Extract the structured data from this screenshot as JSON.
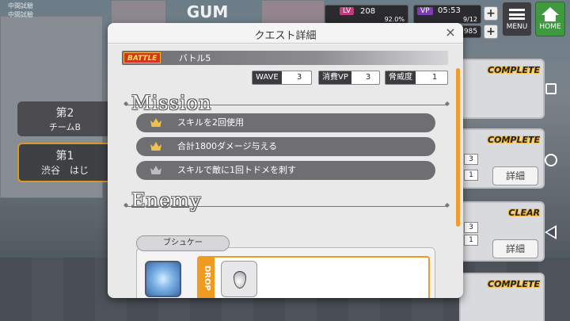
{
  "top_left": {
    "line1": "中間試驗",
    "line2": "中間試驗"
  },
  "background_sign": "GUM",
  "status": {
    "lv_label": "LV",
    "lv_value": "208",
    "lv_progress_label": "92.0%",
    "vp_label": "VP",
    "vp_time": "05:53",
    "vp_frac": "9/12",
    "coins": "985"
  },
  "menu_label": "MENU",
  "home_label": "HOME",
  "left_panels": {
    "chapter_a": "第2",
    "team": "チームB",
    "chapter_b": "第1",
    "place": "渋谷　はじ"
  },
  "quest_list": [
    {
      "status": "COMPLETE",
      "nums": [
        "",
        ""
      ],
      "detail": ""
    },
    {
      "status": "COMPLETE",
      "nums": [
        "3",
        "1"
      ],
      "detail": "詳細"
    },
    {
      "status": "CLEAR",
      "nums": [
        "3",
        "1"
      ],
      "detail": "詳細"
    },
    {
      "status": "COMPLETE",
      "nums": [
        "",
        ""
      ],
      "detail": ""
    }
  ],
  "modal": {
    "title": "クエスト詳細",
    "close_glyph": "×",
    "battle_badge": "BATTLE",
    "battle_name": "バトル5",
    "stats": [
      {
        "label": "WAVE",
        "value": "3"
      },
      {
        "label": "消費VP",
        "value": "3"
      },
      {
        "label": "脅威度",
        "value": "1"
      }
    ],
    "mission_title": "Mission",
    "missions": [
      {
        "text": "スキルを2回使用",
        "achieved": true
      },
      {
        "text": "合計1800ダメージ与える",
        "achieved": true
      },
      {
        "text": "スキルで敵に1回トドメを刺す",
        "achieved": false
      }
    ],
    "enemy_title": "Enemy",
    "enemy_name": "ブシュケー",
    "drop_label": "DROP"
  },
  "colors": {
    "accent": "#f09a22",
    "crown_gold": "#f0c04a",
    "crown_gray": "#bdbdbd"
  }
}
